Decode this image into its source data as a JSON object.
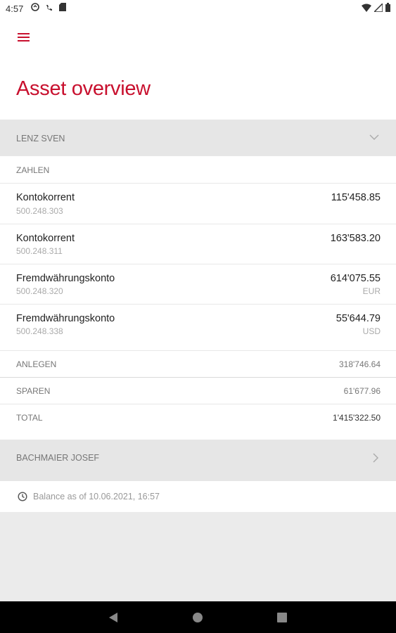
{
  "status_bar": {
    "time": "4:57",
    "left_icons": [
      "sync-icon",
      "wifi-calling-icon",
      "sd-card-icon"
    ],
    "right_icons": [
      "wifi-icon",
      "signal-icon",
      "battery-icon"
    ]
  },
  "header": {
    "menu_icon": "hamburger-menu-icon",
    "title": "Asset overview"
  },
  "accounts_holder": {
    "name": "LENZ SVEN",
    "expanded": true
  },
  "payments_section": {
    "label": "ZAHLEN",
    "accounts": [
      {
        "name": "Kontokorrent",
        "number": "500.248.303",
        "balance": "115'458.85",
        "currency": ""
      },
      {
        "name": "Kontokorrent",
        "number": "500.248.311",
        "balance": "163'583.20",
        "currency": ""
      },
      {
        "name": "Fremdwährungskonto",
        "number": "500.248.320",
        "balance": "614'075.55",
        "currency": "EUR"
      },
      {
        "name": "Fremdwährungskonto",
        "number": "500.248.338",
        "balance": "55'644.79",
        "currency": "USD"
      }
    ]
  },
  "summary": [
    {
      "label": "ANLEGEN",
      "value": "318'746.64"
    },
    {
      "label": "SPAREN",
      "value": "61'677.96"
    },
    {
      "label": "TOTAL",
      "value": "1'415'322.50"
    }
  ],
  "second_holder": {
    "name": "BACHMAIER JOSEF",
    "expanded": false
  },
  "balance_note": {
    "icon": "clock-icon",
    "text": "Balance as of 10.06.2021, 16:57"
  },
  "nav_bar": {
    "back_icon": "back-triangle-icon",
    "home_icon": "home-circle-icon",
    "recents_icon": "recents-square-icon"
  },
  "colors": {
    "accent": "#c8102e",
    "background": "#ebebeb",
    "section_header": "#e6e6e6"
  }
}
